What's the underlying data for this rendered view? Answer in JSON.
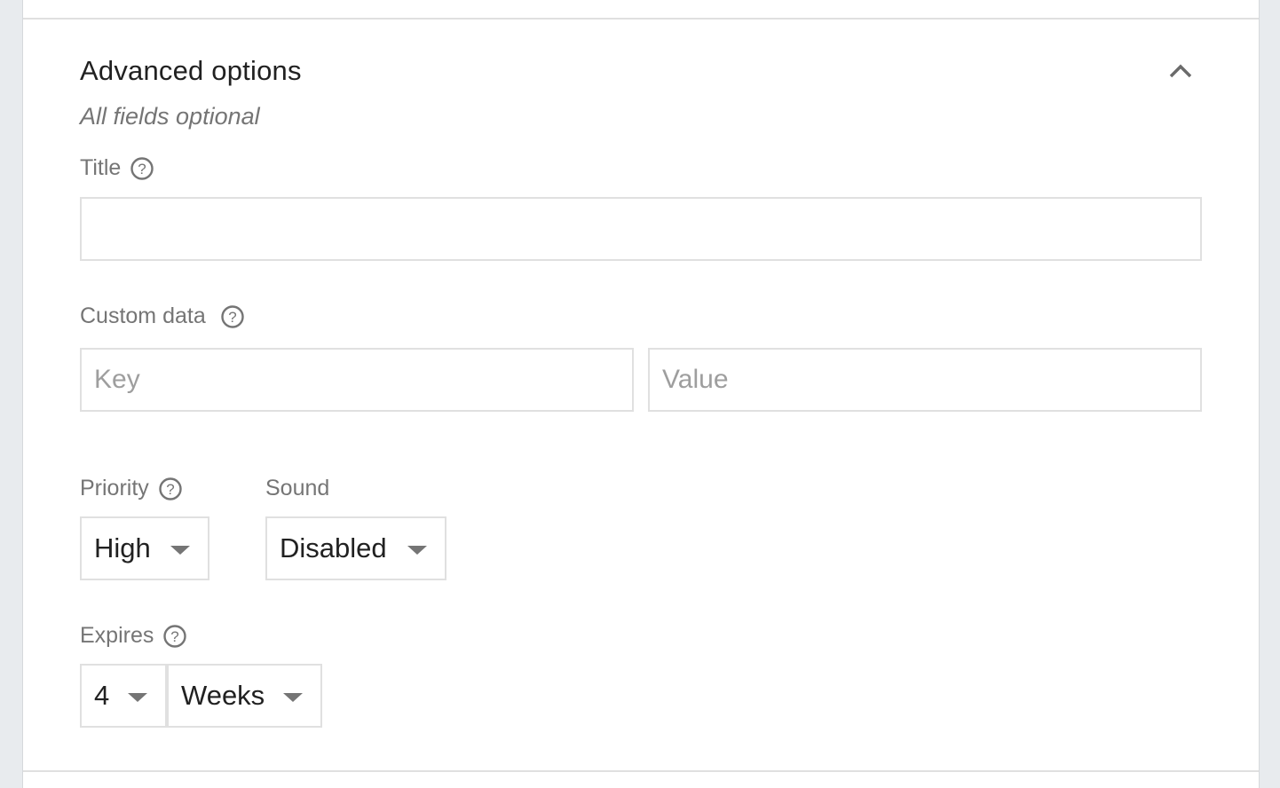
{
  "section": {
    "title": "Advanced options",
    "subtitle": "All fields optional",
    "collapse_icon": "chevron-up-icon"
  },
  "fields": {
    "title": {
      "label": "Title",
      "help_icon": "help-circle-icon",
      "value": "",
      "placeholder": ""
    },
    "custom_data": {
      "label": "Custom data",
      "help_icon": "help-circle-icon",
      "key_placeholder": "Key",
      "value_placeholder": "Value",
      "key_value": "",
      "value_value": ""
    },
    "priority": {
      "label": "Priority",
      "help_icon": "help-circle-icon",
      "selected": "High"
    },
    "sound": {
      "label": "Sound",
      "selected": "Disabled"
    },
    "expires": {
      "label": "Expires",
      "help_icon": "help-circle-icon",
      "amount_selected": "4",
      "unit_selected": "Weeks"
    }
  },
  "colors": {
    "background": "#e8ebee",
    "card": "#ffffff",
    "border": "#e0e0e0",
    "text_primary": "#212121",
    "text_secondary": "#757575",
    "placeholder": "#9e9e9e"
  }
}
